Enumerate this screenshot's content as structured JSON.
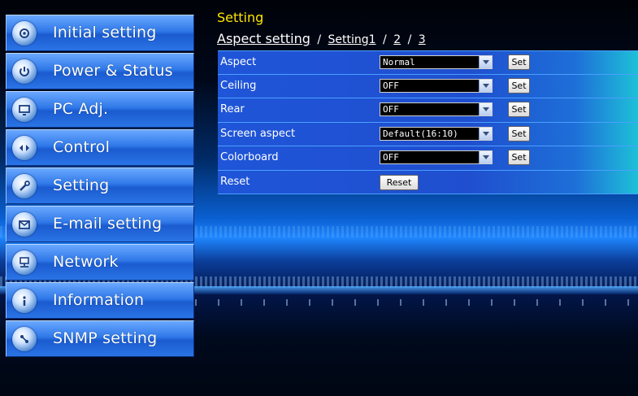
{
  "sidebar": {
    "items": [
      {
        "label": "Initial setting",
        "icon": "initial-setting-icon"
      },
      {
        "label": "Power & Status",
        "icon": "power-status-icon"
      },
      {
        "label": "PC Adj.",
        "icon": "pc-adjust-icon"
      },
      {
        "label": "Control",
        "icon": "control-icon"
      },
      {
        "label": "Setting",
        "icon": "setting-icon"
      },
      {
        "label": "E-mail setting",
        "icon": "email-icon"
      },
      {
        "label": "Network",
        "icon": "network-icon"
      },
      {
        "label": "Information",
        "icon": "information-icon"
      },
      {
        "label": "SNMP setting",
        "icon": "snmp-icon"
      }
    ]
  },
  "header": {
    "title": "Setting",
    "current": "Aspect setting",
    "sep": "/",
    "links": [
      "Setting1",
      "2",
      "3"
    ]
  },
  "rows": [
    {
      "label": "Aspect",
      "value": "Normal",
      "button": "Set"
    },
    {
      "label": "Ceiling",
      "value": "OFF",
      "button": "Set"
    },
    {
      "label": "Rear",
      "value": "OFF",
      "button": "Set"
    },
    {
      "label": "Screen aspect",
      "value": "Default(16:10)",
      "button": "Set"
    },
    {
      "label": "Colorboard",
      "value": "OFF",
      "button": "Set"
    },
    {
      "label": "Reset",
      "button": "Reset"
    }
  ],
  "colors": {
    "title": "#ffe600",
    "sidebar_button": "#2f78e8",
    "row_bg": "#1f55d8",
    "background": "#000814"
  }
}
